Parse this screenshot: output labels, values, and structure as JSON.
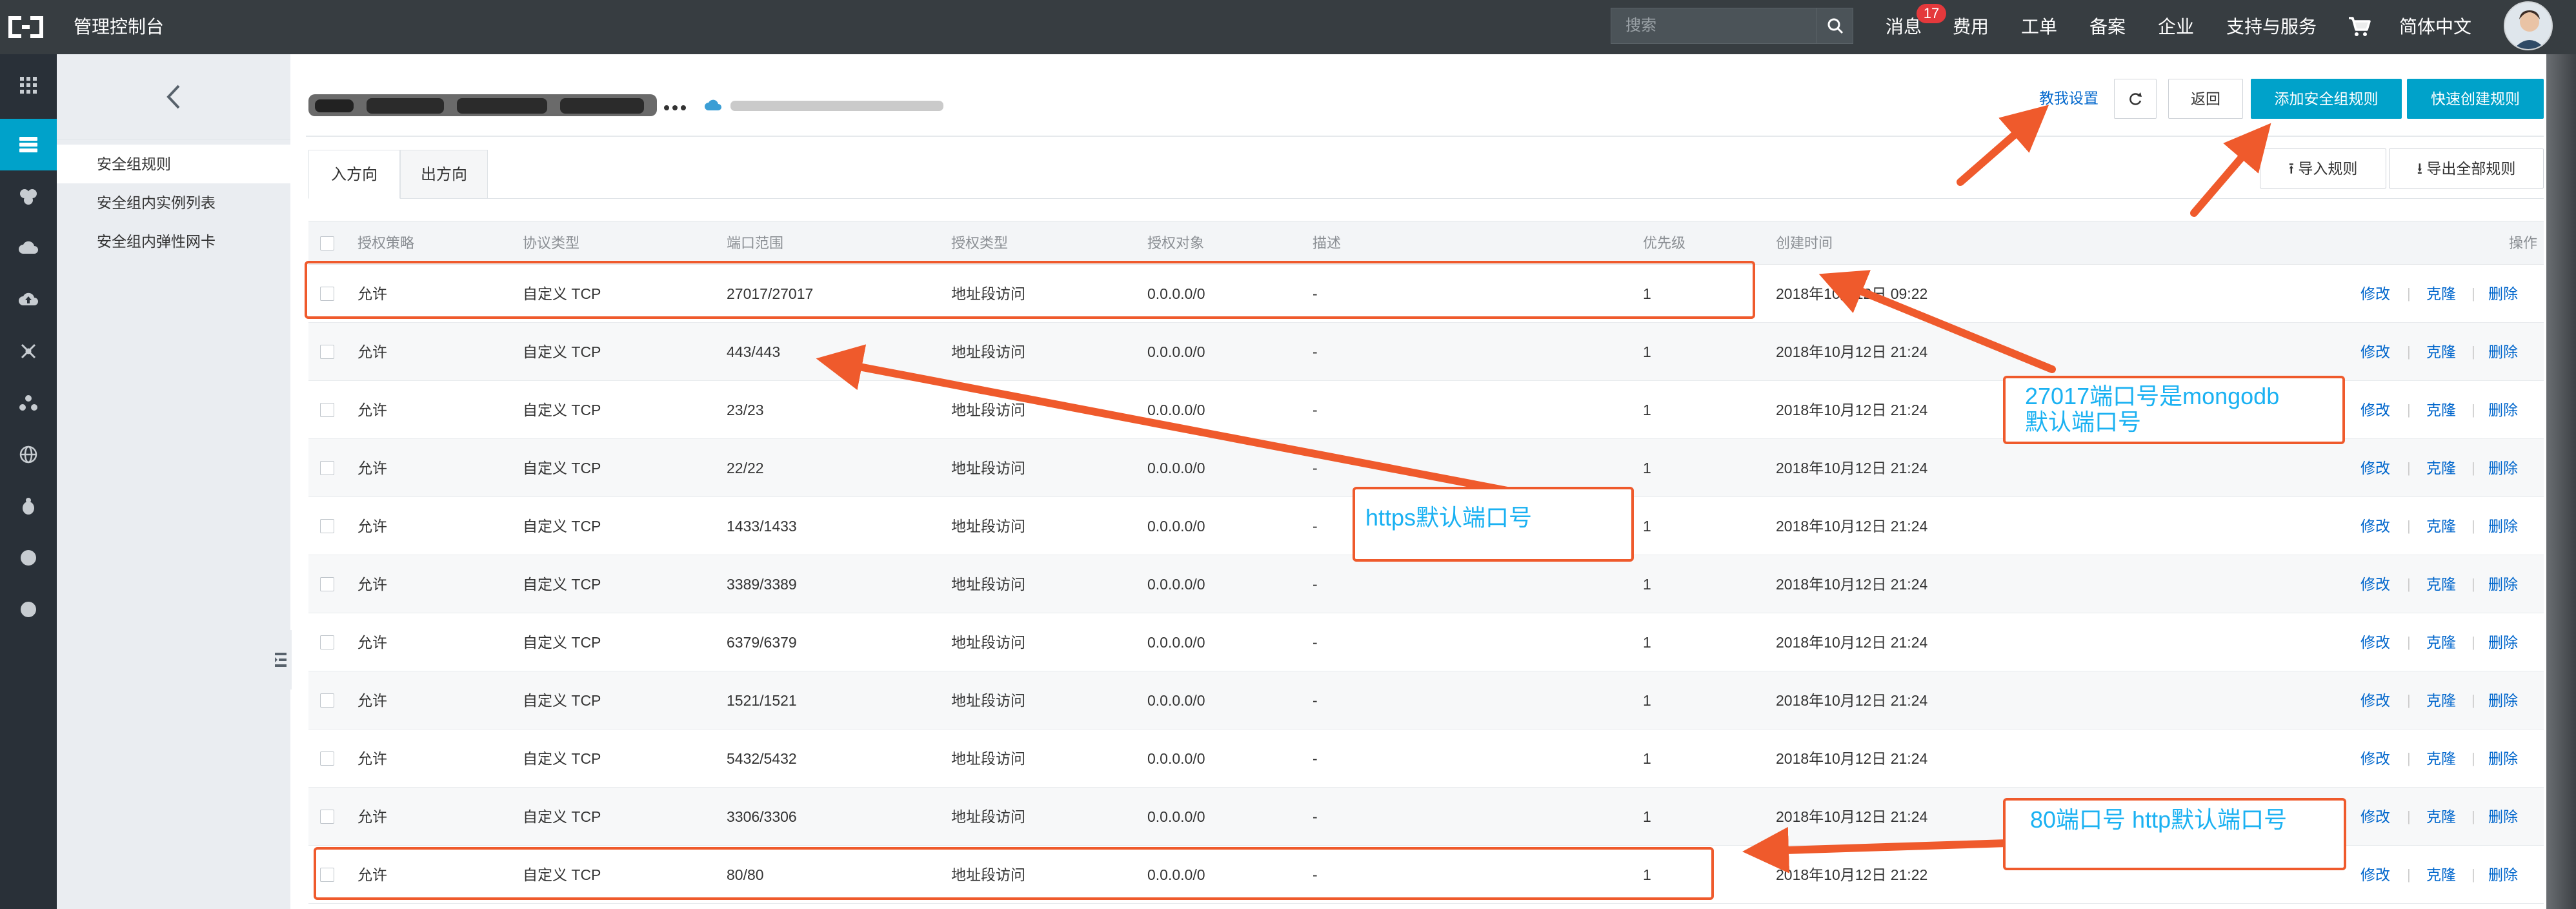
{
  "topbar": {
    "title": "管理控制台",
    "search_placeholder": "搜索",
    "nav": [
      "消息",
      "费用",
      "工单",
      "备案",
      "企业",
      "支持与服务"
    ],
    "badge": "17",
    "language": "简体中文"
  },
  "subnav": {
    "items": [
      "安全组规则",
      "安全组内实例列表",
      "安全组内弹性网卡"
    ]
  },
  "header": {
    "help_link": "教我设置",
    "buttons": {
      "back": "返回",
      "add_rule": "添加安全组规则",
      "quick_create": "快速创建规则",
      "import": "导入规则",
      "export": "导出全部规则"
    }
  },
  "tabs": [
    "入方向",
    "出方向"
  ],
  "table": {
    "columns": [
      "授权策略",
      "协议类型",
      "端口范围",
      "授权类型",
      "授权对象",
      "描述",
      "优先级",
      "创建时间",
      "操作"
    ],
    "actions": [
      "修改",
      "克隆",
      "删除"
    ],
    "rows": [
      {
        "policy": "允许",
        "protocol": "自定义 TCP",
        "port": "27017/27017",
        "auth_type": "地址段访问",
        "target": "0.0.0.0/0",
        "desc": "-",
        "priority": "1",
        "created": "2018年10月12日 09:22"
      },
      {
        "policy": "允许",
        "protocol": "自定义 TCP",
        "port": "443/443",
        "auth_type": "地址段访问",
        "target": "0.0.0.0/0",
        "desc": "-",
        "priority": "1",
        "created": "2018年10月12日 21:24"
      },
      {
        "policy": "允许",
        "protocol": "自定义 TCP",
        "port": "23/23",
        "auth_type": "地址段访问",
        "target": "0.0.0.0/0",
        "desc": "-",
        "priority": "1",
        "created": "2018年10月12日 21:24"
      },
      {
        "policy": "允许",
        "protocol": "自定义 TCP",
        "port": "22/22",
        "auth_type": "地址段访问",
        "target": "0.0.0.0/0",
        "desc": "-",
        "priority": "1",
        "created": "2018年10月12日 21:24"
      },
      {
        "policy": "允许",
        "protocol": "自定义 TCP",
        "port": "1433/1433",
        "auth_type": "地址段访问",
        "target": "0.0.0.0/0",
        "desc": "-",
        "priority": "1",
        "created": "2018年10月12日 21:24"
      },
      {
        "policy": "允许",
        "protocol": "自定义 TCP",
        "port": "3389/3389",
        "auth_type": "地址段访问",
        "target": "0.0.0.0/0",
        "desc": "-",
        "priority": "1",
        "created": "2018年10月12日 21:24"
      },
      {
        "policy": "允许",
        "protocol": "自定义 TCP",
        "port": "6379/6379",
        "auth_type": "地址段访问",
        "target": "0.0.0.0/0",
        "desc": "-",
        "priority": "1",
        "created": "2018年10月12日 21:24"
      },
      {
        "policy": "允许",
        "protocol": "自定义 TCP",
        "port": "1521/1521",
        "auth_type": "地址段访问",
        "target": "0.0.0.0/0",
        "desc": "-",
        "priority": "1",
        "created": "2018年10月12日 21:24"
      },
      {
        "policy": "允许",
        "protocol": "自定义 TCP",
        "port": "5432/5432",
        "auth_type": "地址段访问",
        "target": "0.0.0.0/0",
        "desc": "-",
        "priority": "1",
        "created": "2018年10月12日 21:24"
      },
      {
        "policy": "允许",
        "protocol": "自定义 TCP",
        "port": "3306/3306",
        "auth_type": "地址段访问",
        "target": "0.0.0.0/0",
        "desc": "-",
        "priority": "1",
        "created": "2018年10月12日 21:24"
      },
      {
        "policy": "允许",
        "protocol": "自定义 TCP",
        "port": "80/80",
        "auth_type": "地址段访问",
        "target": "0.0.0.0/0",
        "desc": "-",
        "priority": "1",
        "created": "2018年10月12日 21:22"
      }
    ]
  },
  "annotations": {
    "mongodb": [
      "27017端口号是mongodb",
      "默认端口号"
    ],
    "https": "https默认端口号",
    "http": "80端口号 http默认端口号"
  },
  "colors": {
    "topbar": "#373d41",
    "rail": "#293038",
    "accent": "#00a2ca",
    "link": "#0066cc",
    "annotation_red": "#ef5a2c",
    "annotation_text": "#1ab1f2"
  }
}
